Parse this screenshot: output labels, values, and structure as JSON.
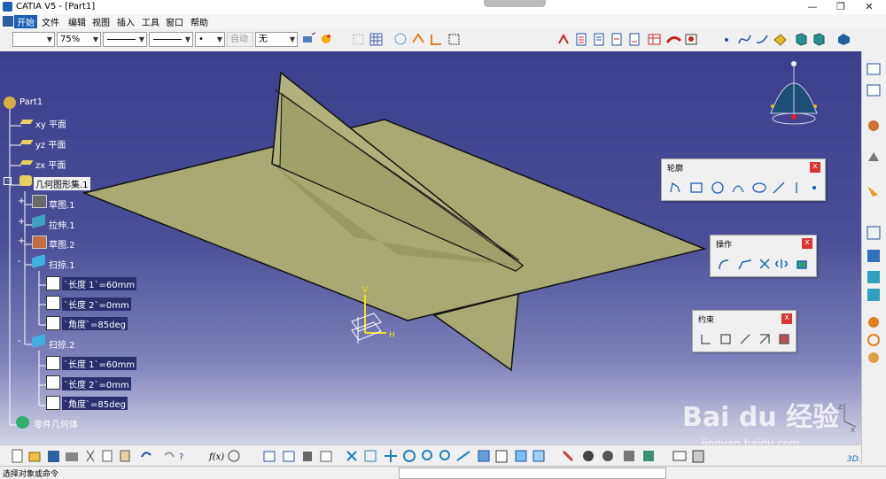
{
  "window": {
    "title": "CATIA V5 - [Part1]",
    "minimize": "—",
    "maximize": "❐",
    "close": "✕"
  },
  "menu": {
    "items": [
      "开始",
      "文件",
      "编辑",
      "视图",
      "插入",
      "工具",
      "窗口",
      "帮助"
    ]
  },
  "toolbar": {
    "zoom_value": "75%",
    "auto_label": "自动",
    "layer_value": "无",
    "point_style": "•"
  },
  "tree": {
    "root": "Part1",
    "planes": [
      "xy 平面",
      "yz 平面",
      "zx 平面"
    ],
    "geoset": "几何图形集.1",
    "items": [
      "草图.1",
      "拉伸.1",
      "草图.2"
    ],
    "sweeps": [
      {
        "label": "扫掠.1",
        "params": [
          "`长度 1`=60mm",
          "`长度 2`=0mm",
          "`角度`=85deg"
        ]
      },
      {
        "label": "扫掠.2",
        "params": [
          "`长度 1`=60mm",
          "`长度 2`=0mm",
          "`角度`=85deg"
        ]
      }
    ],
    "body": "零件几何体"
  },
  "panels": {
    "profile": "轮廓",
    "operation": "操作",
    "constraint": "约束",
    "close_glyph": "x"
  },
  "axis": {
    "v": "V",
    "h": "H",
    "z": "z",
    "x": "x"
  },
  "watermark": {
    "brand": "Bai du 经验",
    "url": "jingyan.baidu.com"
  },
  "status": {
    "text": "选择对象或命令"
  },
  "colors": {
    "surface": "#a8a973",
    "surface_dark": "#8b8c58",
    "background_top": "#3c3f8c",
    "accent": "#1a5fb4"
  }
}
